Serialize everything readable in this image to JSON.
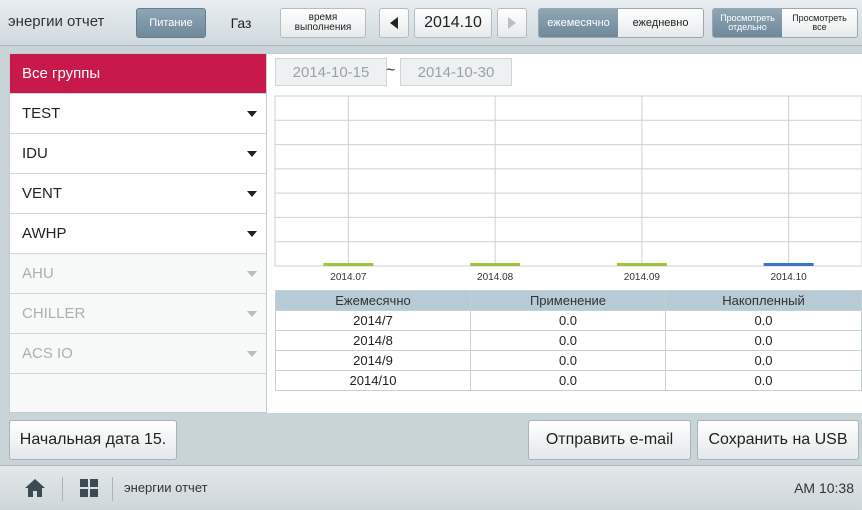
{
  "topbar": {
    "title": "энергии отчет",
    "type_tabs": [
      {
        "label": "Питание",
        "active": true
      },
      {
        "label": "Газ",
        "active": false
      }
    ],
    "runtime_label": "время выполнения",
    "period_value": "2014.10",
    "mode_tabs": [
      {
        "label": "ежемесячно",
        "active": true
      },
      {
        "label": "ежедневно",
        "active": false
      }
    ],
    "view_tabs": [
      {
        "label": "Просмотреть отдельно",
        "active": true
      },
      {
        "label": "Просмотреть все",
        "active": false
      }
    ]
  },
  "sidebar": {
    "header": "Все группы",
    "groups": [
      {
        "label": "TEST",
        "enabled": true
      },
      {
        "label": "IDU",
        "enabled": true
      },
      {
        "label": "VENT",
        "enabled": true
      },
      {
        "label": "AWHP",
        "enabled": true
      },
      {
        "label": "AHU",
        "enabled": false
      },
      {
        "label": "CHILLER",
        "enabled": false
      },
      {
        "label": "ACS IO",
        "enabled": false
      }
    ]
  },
  "range": {
    "start": "2014-10-15",
    "separator": "~",
    "end": "2014-10-30"
  },
  "chart_data": {
    "type": "bar",
    "categories": [
      "2014.07",
      "2014.08",
      "2014.09",
      "2014.10"
    ],
    "values": [
      0.0,
      0.0,
      0.0,
      0.0
    ],
    "colors": [
      "#a3c23c",
      "#a3c23c",
      "#a3c23c",
      "#3b73c8"
    ],
    "grid": true
  },
  "table": {
    "headers": [
      "Ежемесячно",
      "Применение",
      "Накопленный"
    ],
    "rows": [
      [
        "2014/7",
        "0.0",
        "0.0"
      ],
      [
        "2014/8",
        "0.0",
        "0.0"
      ],
      [
        "2014/9",
        "0.0",
        "0.0"
      ],
      [
        "2014/10",
        "0.0",
        "0.0"
      ]
    ]
  },
  "actions": {
    "start_date": "Начальная дата 15.",
    "send_email": "Отправить e-mail",
    "save_usb": "Сохранить на USB"
  },
  "statusbar": {
    "breadcrumb": "энергии отчет",
    "clock": "AM 10:38",
    "icons": [
      "home-icon",
      "grid-menu-icon"
    ]
  },
  "colors": {
    "accent": "#c8194b",
    "active_tab": "#7b95a4",
    "bar_past": "#a3c23c",
    "bar_current": "#3b73c8",
    "table_header": "#b7cbd6"
  }
}
